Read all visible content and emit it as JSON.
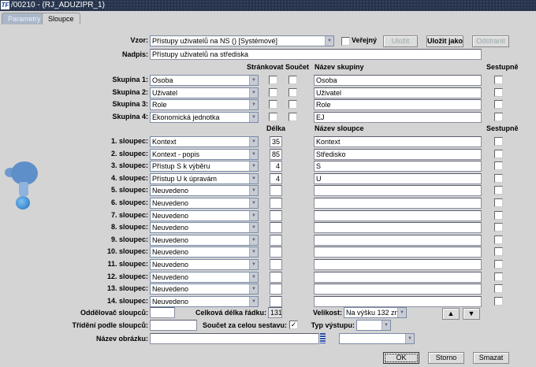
{
  "window": {
    "title": "/00210 - (RJ_ADUZIPR_1)",
    "icon": "tf-app-icon"
  },
  "tabs": [
    {
      "label": "Parametry"
    },
    {
      "label": "Sloupce",
      "active": true
    }
  ],
  "vzor": {
    "label": "Vzor:",
    "value": "Přístupy uživatelů na NS  ()  [Systémové]"
  },
  "verejny": {
    "label": "Veřejný",
    "checked": false
  },
  "buttons": {
    "save": "Uložit",
    "save_as": "Uložit jako",
    "remove": "Odstranit",
    "ok": "OK",
    "cancel": "Storno",
    "delete": "Smazat"
  },
  "nadpis": {
    "label": "Nadpis:",
    "value": "Přístupy uživatelů na střediska"
  },
  "group_headers": {
    "paging": "Stránkovat",
    "sum": "Součet",
    "name": "Název skupiny",
    "desc": "Sestupně"
  },
  "groups": [
    {
      "label": "Skupina 1:",
      "value": "Osoba",
      "name": "Osoba"
    },
    {
      "label": "Skupina 2:",
      "value": "Uživatel",
      "name": "Uživatel"
    },
    {
      "label": "Skupina 3:",
      "value": "Role",
      "name": "Role"
    },
    {
      "label": "Skupina 4:",
      "value": "Ekonomická jednotka",
      "name": "EJ"
    }
  ],
  "column_headers": {
    "length": "Délka",
    "name": "Název sloupce",
    "desc": "Sestupně"
  },
  "columns": [
    {
      "label": "1. sloupec:",
      "value": "Kontext",
      "length": "35",
      "name": "Kontext"
    },
    {
      "label": "2. sloupec:",
      "value": "Kontext - popis",
      "length": "85",
      "name": "Středisko"
    },
    {
      "label": "3. sloupec:",
      "value": "Přístup S k výběru",
      "length": "4",
      "name": "S"
    },
    {
      "label": "4. sloupec:",
      "value": "Přístup U k úpravám",
      "length": "4",
      "name": "U"
    },
    {
      "label": "5. sloupec:",
      "value": "Neuvedeno",
      "length": "",
      "name": ""
    },
    {
      "label": "6. sloupec:",
      "value": "Neuvedeno",
      "length": "",
      "name": ""
    },
    {
      "label": "7. sloupec:",
      "value": "Neuvedeno",
      "length": "",
      "name": ""
    },
    {
      "label": "8. sloupec:",
      "value": "Neuvedeno",
      "length": "",
      "name": ""
    },
    {
      "label": "9. sloupec:",
      "value": "Neuvedeno",
      "length": "",
      "name": ""
    },
    {
      "label": "10. sloupec:",
      "value": "Neuvedeno",
      "length": "",
      "name": ""
    },
    {
      "label": "11. sloupec:",
      "value": "Neuvedeno",
      "length": "",
      "name": ""
    },
    {
      "label": "12. sloupec:",
      "value": "Neuvedeno",
      "length": "",
      "name": ""
    },
    {
      "label": "13. sloupec:",
      "value": "Neuvedeno",
      "length": "",
      "name": ""
    },
    {
      "label": "14. sloupec:",
      "value": "Neuvedeno",
      "length": "",
      "name": ""
    }
  ],
  "footer": {
    "separator_label": "Oddělovač sloupců:",
    "separator_value": "",
    "total_label": "Celková délka řádku:",
    "total_value": "131",
    "size_label": "Velikost:",
    "size_value": "Na výšku 132 zn.",
    "sort_label": "Třídění podle sloupců:",
    "sort_value": "",
    "sum_all_label": "Součet za celou sestavu:",
    "sum_all_checked": true,
    "output_label": "Typ výstupu:",
    "output_value": "",
    "image_label": "Název obrázku:",
    "image_value": "",
    "image_select": ""
  }
}
